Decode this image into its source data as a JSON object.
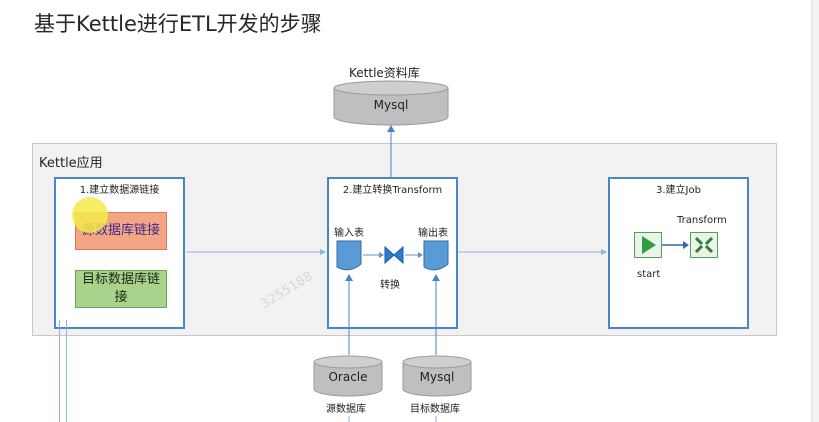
{
  "title": "基于Kettle进行ETL开发的步骤",
  "repository": {
    "label": "Kettle资料库",
    "db": "Mysql"
  },
  "app": {
    "label": "Kettle应用",
    "step1": {
      "title": "1.建立数据源链接",
      "source_conn": "源数据库链接",
      "target_conn": "目标数据库链接"
    },
    "step2": {
      "title": "2.建立转换Transform",
      "input_label": "输入表",
      "output_label": "出表",
      "output_prefix": "输",
      "convert_label": "转换"
    },
    "step3": {
      "title": "3.建立Job",
      "start_label": "start",
      "transform_label": "Transform"
    }
  },
  "sources": [
    {
      "db": "Oracle",
      "caption": "源数据库"
    },
    {
      "db": "Mysql",
      "caption": "目标数据库"
    }
  ],
  "watermark": "3255188",
  "colors": {
    "panel_border": "#4a86c5",
    "source_fill": "#f4a684",
    "target_fill": "#a9d38d",
    "cylinder": "#bfbfbf",
    "table_icon": "#5b9bd5",
    "start_icon": "#2e9e3e"
  },
  "icons": [
    "table-icon",
    "bowtie-convert-icon",
    "start-play-icon",
    "transform-icon",
    "cylinder-db-icon"
  ]
}
